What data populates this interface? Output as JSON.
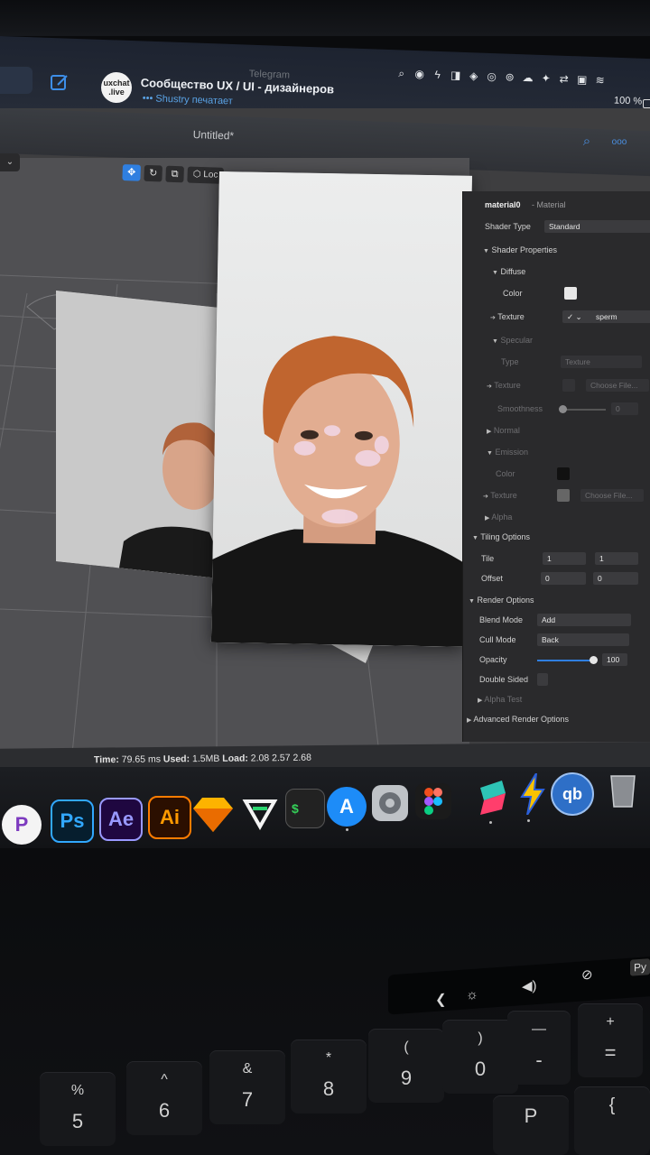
{
  "menubar": {
    "app_name": "Telegram",
    "chat_avatar_text": "uxchat\n.live",
    "chat_title": "Сообщество UX / UI - дизайнеров",
    "chat_status": "••• Shustry печатает",
    "battery": "100 %"
  },
  "window": {
    "title": "Untitled*",
    "toolbar": {
      "local_label": "Loc"
    }
  },
  "inspector": {
    "material_name": "material0",
    "material_kind": "- Material",
    "shader_type_label": "Shader Type",
    "shader_type_value": "Standard",
    "shader_properties": "Shader Properties",
    "diffuse": "Diffuse",
    "color_label": "Color",
    "texture_label": "Texture",
    "texture_value": "sperm",
    "specular": "Specular",
    "type_label": "Type",
    "type_value": "Texture",
    "spec_texture_label": "Texture",
    "choose_file": "Choose File...",
    "smoothness_label": "Smoothness",
    "smoothness_value": "0",
    "normal": "Normal",
    "emission": "Emission",
    "em_color_label": "Color",
    "em_texture_label": "Texture",
    "em_choose_file": "Choose File...",
    "alpha": "Alpha",
    "tiling_options": "Tiling Options",
    "tile_label": "Tile",
    "tile_x": "1",
    "tile_y": "1",
    "offset_label": "Offset",
    "offset_x": "0",
    "offset_y": "0",
    "render_options": "Render Options",
    "blend_mode_label": "Blend Mode",
    "blend_mode_value": "Add",
    "cull_mode_label": "Cull Mode",
    "cull_mode_value": "Back",
    "opacity_label": "Opacity",
    "opacity_value": "100",
    "double_sided_label": "Double Sided",
    "alpha_test_label": "Alpha Test",
    "advanced_render_options": "Advanced Render Options"
  },
  "statusbar": {
    "time_label": "Time:",
    "time_value": "79.65 ms",
    "used_label": "Used:",
    "used_value": "1.5MB",
    "load_label": "Load:",
    "load_value": "2.08 2.57 2.68"
  },
  "dock": {
    "icons": [
      {
        "name": "pockity",
        "glyph": "P"
      },
      {
        "name": "photoshop",
        "glyph": "Ps"
      },
      {
        "name": "after-effects",
        "glyph": "Ae"
      },
      {
        "name": "illustrator",
        "glyph": "Ai"
      },
      {
        "name": "sketch",
        "glyph": ""
      },
      {
        "name": "vectornator",
        "glyph": ""
      },
      {
        "name": "terminal",
        "glyph": "$"
      },
      {
        "name": "app-store",
        "glyph": "A"
      },
      {
        "name": "system-preferences",
        "glyph": ""
      },
      {
        "name": "figma",
        "glyph": ""
      },
      {
        "name": "spark",
        "glyph": ""
      },
      {
        "name": "reeder",
        "glyph": ""
      },
      {
        "name": "qbittorrent",
        "glyph": "qb"
      },
      {
        "name": "trash",
        "glyph": ""
      }
    ]
  },
  "keyboard": {
    "keys": [
      {
        "top": "%",
        "bot": "5"
      },
      {
        "top": "^",
        "bot": "6"
      },
      {
        "top": "&",
        "bot": "7"
      },
      {
        "top": "*",
        "bot": "8"
      },
      {
        "top": "(",
        "bot": "9"
      },
      {
        "top": ")",
        "bot": "0"
      },
      {
        "top": "—",
        "bot": "-"
      },
      {
        "top": "+",
        "bot": "="
      }
    ],
    "bottom_keys": [
      "P",
      "{"
    ]
  },
  "touchbar": {
    "lang": "Ру"
  }
}
